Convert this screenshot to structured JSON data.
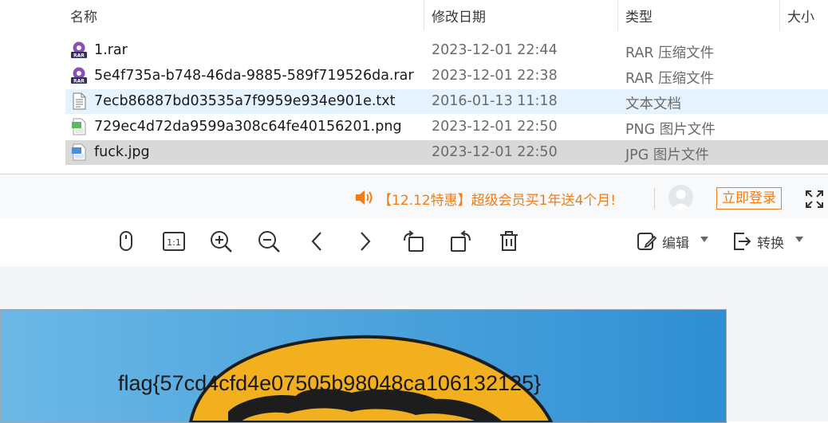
{
  "explorer": {
    "columns": {
      "name": "名称",
      "date": "修改日期",
      "type": "类型",
      "size": "大小"
    },
    "files": [
      {
        "name": "1.rar",
        "date": "2023-12-01 22:44",
        "type": "RAR 压缩文件",
        "icon": "rar-file-icon",
        "state": "normal"
      },
      {
        "name": "5e4f735a-b748-46da-9885-589f719526da.rar",
        "date": "2023-12-01 22:38",
        "type": "RAR 压缩文件",
        "icon": "rar-file-icon",
        "state": "normal"
      },
      {
        "name": "7ecb86887bd03535a7f9959e934e901e.txt",
        "date": "2016-01-13 11:18",
        "type": "文本文档",
        "icon": "text-file-icon",
        "state": "hover"
      },
      {
        "name": "729ec4d72da9599a308c64fe40156201.png",
        "date": "2023-12-01 22:50",
        "type": "PNG 图片文件",
        "icon": "png-file-icon",
        "state": "normal"
      },
      {
        "name": "fuck.jpg",
        "date": "2023-12-01 22:50",
        "type": "JPG 图片文件",
        "icon": "jpg-file-icon",
        "state": "selected"
      }
    ]
  },
  "viewer": {
    "promo": "【12.12特惠】超级会员买1年送4个月!",
    "login": "立即登录",
    "toolbar": {
      "edit": "编辑",
      "convert": "转换"
    },
    "image_text": "flag{57cd4cfd4e07505b98048ca106132125}"
  },
  "colors": {
    "accent_orange": "#f07d18",
    "hover_row": "#e5f3ff",
    "selected_row": "#d9d9d9",
    "image_sky": "#4fa6de",
    "image_sun": "#f2b01e"
  }
}
